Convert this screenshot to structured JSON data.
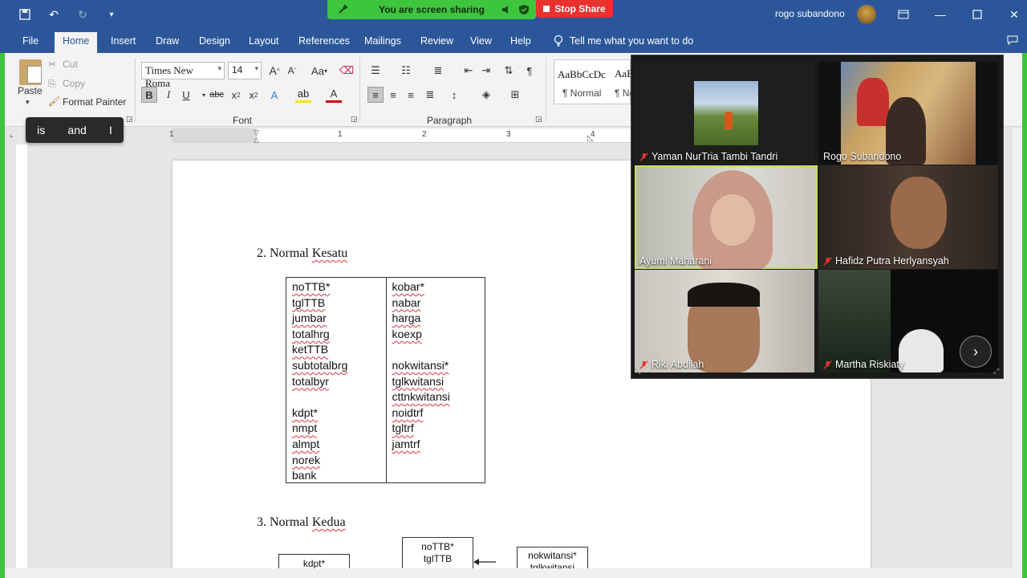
{
  "titlebar": {
    "sharing_text": "You are screen sharing",
    "stop_share": "Stop Share",
    "user_name": "rogo subandono"
  },
  "tabs": [
    {
      "label": "File"
    },
    {
      "label": "Home"
    },
    {
      "label": "Insert"
    },
    {
      "label": "Draw"
    },
    {
      "label": "Design"
    },
    {
      "label": "Layout"
    },
    {
      "label": "References"
    },
    {
      "label": "Mailings"
    },
    {
      "label": "Review"
    },
    {
      "label": "View"
    },
    {
      "label": "Help"
    }
  ],
  "tellme": "Tell me what you want to do",
  "clipboard": {
    "paste": "Paste",
    "cut": "Cut",
    "copy": "Copy",
    "format_painter": "Format Painter"
  },
  "font": {
    "family": "Times New Roma",
    "size": "14",
    "group_label": "Font",
    "grow": "A",
    "shrink": "A",
    "case": "Aa"
  },
  "paragraph": {
    "group_label": "Paragraph"
  },
  "styles": {
    "preview": "AaBbCcDc",
    "name": "Normal",
    "preview2": "AaB",
    "name2": "No"
  },
  "autocomplete": [
    "is",
    "and",
    "I"
  ],
  "ruler": [
    "1",
    "1",
    "2",
    "3",
    "4"
  ],
  "document": {
    "heading2": {
      "num": "2.",
      "word1": "Normal",
      "word2": "Kesatu"
    },
    "table_left": [
      "noTTB*",
      "tglTTB",
      "jumbar",
      "totalhrg",
      "ketTTB",
      "subtotalbrg",
      "totalbyr",
      "",
      "kdpt*",
      "nmpt",
      "almpt",
      "norek",
      "bank"
    ],
    "table_right": [
      "kobar*",
      "nabar",
      "harga",
      "koexp",
      "",
      "nokwitansi*",
      "tglkwitansi",
      "cttnkwitansi",
      "noidtrf",
      "tgltrf",
      "jamtrf"
    ],
    "heading3": {
      "num": "3.",
      "word1": "Normal",
      "word2": "Kedua"
    },
    "box_kdpt": "kdpt*",
    "box_ttb": [
      "noTTB*",
      "tglTTB"
    ],
    "box_kw": [
      "nokwitansi*",
      "tglkwitansi"
    ]
  },
  "participants": [
    {
      "name": "Yaman NurTria Tambi Tandri"
    },
    {
      "name": "Rogo Subandono"
    },
    {
      "name": "Ayumi Maharani"
    },
    {
      "name": "Hafidz Putra Herlyansyah"
    },
    {
      "name": "Riki Abdilah"
    },
    {
      "name": "Martha Riskiaty"
    }
  ],
  "colors": {
    "word_blue": "#2b579a",
    "share_green": "#3ec53e",
    "stop_red": "#e8322e",
    "active_speaker": "#c8e06a"
  }
}
